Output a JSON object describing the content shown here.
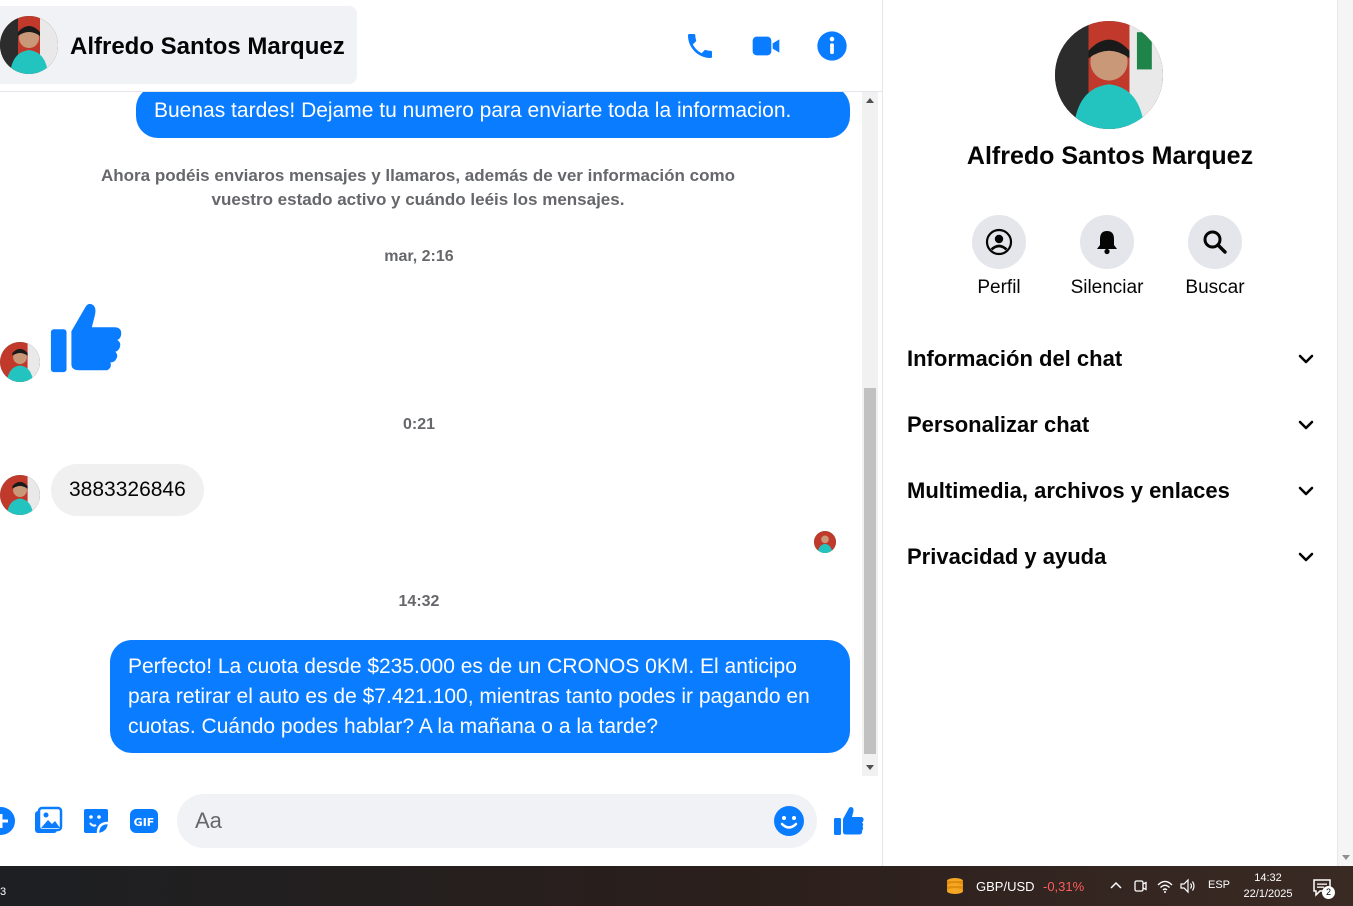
{
  "header": {
    "contact_name": "Alfredo Santos Marquez",
    "actions": [
      "phone-icon",
      "video-camera-icon",
      "info-icon"
    ]
  },
  "messages": {
    "outgoing_1": "Buenas tardes! Dejame tu numero para enviarte toda la informacion.",
    "system_note": "Ahora podéis enviaros mensajes y llamaros, además de ver información como vuestro estado activo y cuándo leéis los mensajes.",
    "timestamp_1": "mar, 2:16",
    "incoming_like": "thumbs-up-icon",
    "timestamp_2": "0:21",
    "incoming_number": "3883326846",
    "timestamp_3": "14:32",
    "outgoing_2": "Perfecto! La cuota desde $235.000 es de un CRONOS 0KM. El anticipo para retirar el auto es de $7.421.100, mientras tanto podes ir pagando en cuotas. Cuándo podes hablar? A la mañana o a la tarde?"
  },
  "composer": {
    "placeholder": "Aa",
    "buttons": [
      "plus-icon",
      "image-icon",
      "sticker-icon",
      "gif-icon",
      "emoji-icon",
      "thumbs-up-icon"
    ],
    "gif_label": "GIF"
  },
  "panel": {
    "name": "Alfredo Santos Marquez",
    "quick_actions": [
      {
        "label": "Perfil",
        "icon": "profile-icon"
      },
      {
        "label": "Silenciar",
        "icon": "bell-icon"
      },
      {
        "label": "Buscar",
        "icon": "search-icon"
      }
    ],
    "sections": [
      {
        "label": "Información del chat"
      },
      {
        "label": "Personalizar chat"
      },
      {
        "label": "Multimedia, archivos y enlaces"
      },
      {
        "label": "Privacidad y ayuda"
      }
    ]
  },
  "taskbar": {
    "left_badge": "3",
    "ticker_pair": "GBP/USD",
    "ticker_change": "-0,31%",
    "language": "ESP",
    "time": "14:32",
    "date": "22/1/2025",
    "notification_count": "2"
  },
  "colors": {
    "accent": "#0a7cff",
    "incoming_bubble": "#f0f0f0",
    "secondary_text": "#65676b",
    "negative": "#ff5c5c"
  }
}
